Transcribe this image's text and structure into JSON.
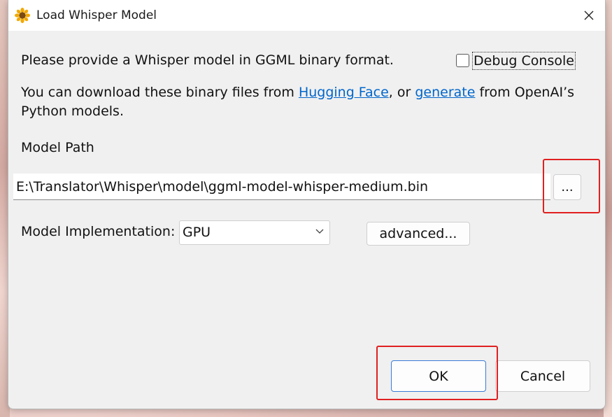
{
  "window": {
    "title": "Load Whisper Model",
    "icon": "sunflower-icon",
    "close_glyph": "✕"
  },
  "content": {
    "intro_text": "Please provide a Whisper model in GGML binary format.",
    "debug_console_label": "Debug Console",
    "debug_console_checked": false,
    "download_prefix": "You can download these binary files from ",
    "hugging_face_link": "Hugging Face",
    "download_middle": ", or ",
    "generate_link": "generate",
    "download_suffix": " from OpenAI’s",
    "download_line2": "Python models.",
    "model_path_label": "Model Path",
    "model_path_value": "E:\\Translator\\Whisper\\model\\ggml-model-whisper-medium.bin",
    "browse_label": "...",
    "implementation_label": "Model Implementation:",
    "implementation_value": "GPU",
    "advanced_label": "advanced..."
  },
  "buttons": {
    "ok_label": "OK",
    "cancel_label": "Cancel"
  },
  "colors": {
    "link": "#0066cc",
    "highlight": "#e02020",
    "dialog_bg": "#f0f0f0"
  }
}
